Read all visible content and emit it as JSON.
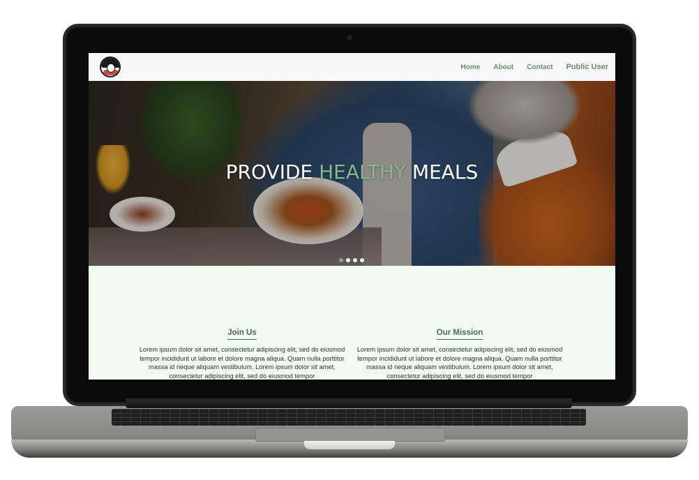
{
  "nav": {
    "links": [
      {
        "label": "Home"
      },
      {
        "label": "About"
      },
      {
        "label": "Contact"
      }
    ],
    "user_label": "Public User"
  },
  "hero": {
    "title_part1": "PROVIDE ",
    "title_accent": "HEALTHY",
    "title_part2": " MEALS",
    "slide_count": 4,
    "active_slide": 1
  },
  "sections": [
    {
      "heading": "Join Us",
      "body": "Lorem ipsum dolor sit amet, consectetur adipiscing elit, sed do eiusmod tempor incididunt ut labore et dolore magna aliqua. Quam nulla porttitor massa id neque aliquam vestibulum. Lorem ipsum dolor sit amet, consectetur adipiscing elit, sed do eiusmod tempor"
    },
    {
      "heading": "Our Mission",
      "body": "Lorem ipsum dolor sit amet, consectetur adipiscing elit, sed do eiusmod tempor incididunt ut labore et dolore magna aliqua. Quam nulla porttitor massa id neque aliquam vestibulum. Lorem ipsum dolor sit amet, consectetur adipiscing elit, sed do eiusmod tempor"
    }
  ],
  "colors": {
    "nav_link": "#6e8b6e",
    "accent": "#86b892",
    "content_bg": "#f1faf1",
    "heading": "#4f6a4f"
  }
}
